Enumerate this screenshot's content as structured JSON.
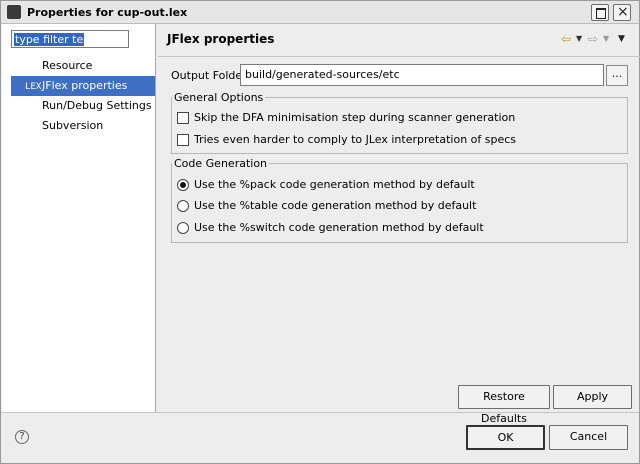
{
  "window": {
    "title": "Properties for cup-out.lex"
  },
  "filter": {
    "placeholder": "type filter text"
  },
  "tree": {
    "items": [
      {
        "label": "Resource"
      },
      {
        "label": "JFlex properties",
        "badge": "LEX",
        "selected": true
      },
      {
        "label": "Run/Debug Settings"
      },
      {
        "label": "Subversion"
      }
    ]
  },
  "page": {
    "heading": "JFlex properties",
    "output_folder_label": "Output Folder",
    "output_folder_value": "build/generated-sources/etc",
    "browse_label": "..."
  },
  "general_options": {
    "legend": "General Options",
    "options": [
      {
        "label": "Skip the DFA minimisation step during scanner generation",
        "checked": false
      },
      {
        "label": "Tries even harder to comply to JLex interpretation of specs",
        "checked": false
      }
    ]
  },
  "code_generation": {
    "legend": "Code Generation",
    "options": [
      {
        "label": "Use the %pack code generation method by default",
        "selected": true
      },
      {
        "label": "Use the %table code generation method by default",
        "selected": false
      },
      {
        "label": "Use the %switch code generation method by default",
        "selected": false
      }
    ]
  },
  "buttons": {
    "restore": "Restore Defaults",
    "apply": "Apply",
    "ok": "OK",
    "cancel": "Cancel"
  },
  "icons": {
    "help": "?",
    "close": "×"
  }
}
